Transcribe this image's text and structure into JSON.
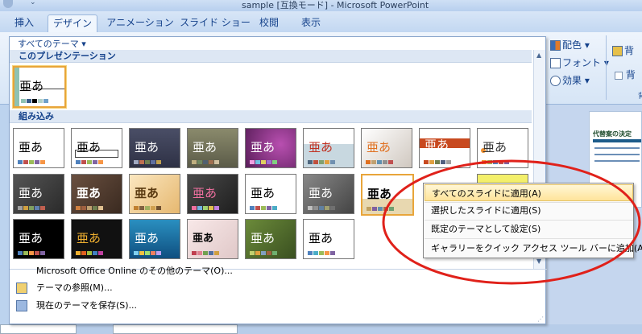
{
  "window": {
    "title": "sample [互換モード] - Microsoft PowerPoint"
  },
  "tabs": [
    {
      "label": "挿入"
    },
    {
      "label": "デザイン"
    },
    {
      "label": "アニメーション"
    },
    {
      "label": "スライド ショー"
    },
    {
      "label": "校閲"
    },
    {
      "label": "表示"
    }
  ],
  "ribbon": {
    "colors_label": "配色",
    "fonts_label": "フォント",
    "effects_label": "効果",
    "background_label": "背",
    "background_label2": "背",
    "group_label_fragment": "背"
  },
  "gallery": {
    "dropdown_label": "すべてのテーマ ▾",
    "section_current": "このプレゼンテーション",
    "section_builtin": "組み込み",
    "sample_text": "亜あ",
    "menu": [
      {
        "label": "Microsoft Office Online のその他のテーマ(O)..."
      },
      {
        "label": "テーマの参照(M)..."
      },
      {
        "label": "現在のテーマを保存(S)..."
      }
    ]
  },
  "context_menu": {
    "items": [
      {
        "label": "すべてのスライドに適用(A)"
      },
      {
        "label": "選択したスライドに適用(S)"
      },
      {
        "label": "既定のテーマとして設定(S)"
      },
      {
        "label": "ギャラリーをクイック アクセス ツール バーに追加(A)"
      }
    ]
  },
  "slide_pane": {
    "heading_fragment": "代替案の決定"
  },
  "colors": {
    "tab_text": "#15428b",
    "annotation": "#e0211a",
    "highlight": "#ffe49a"
  }
}
